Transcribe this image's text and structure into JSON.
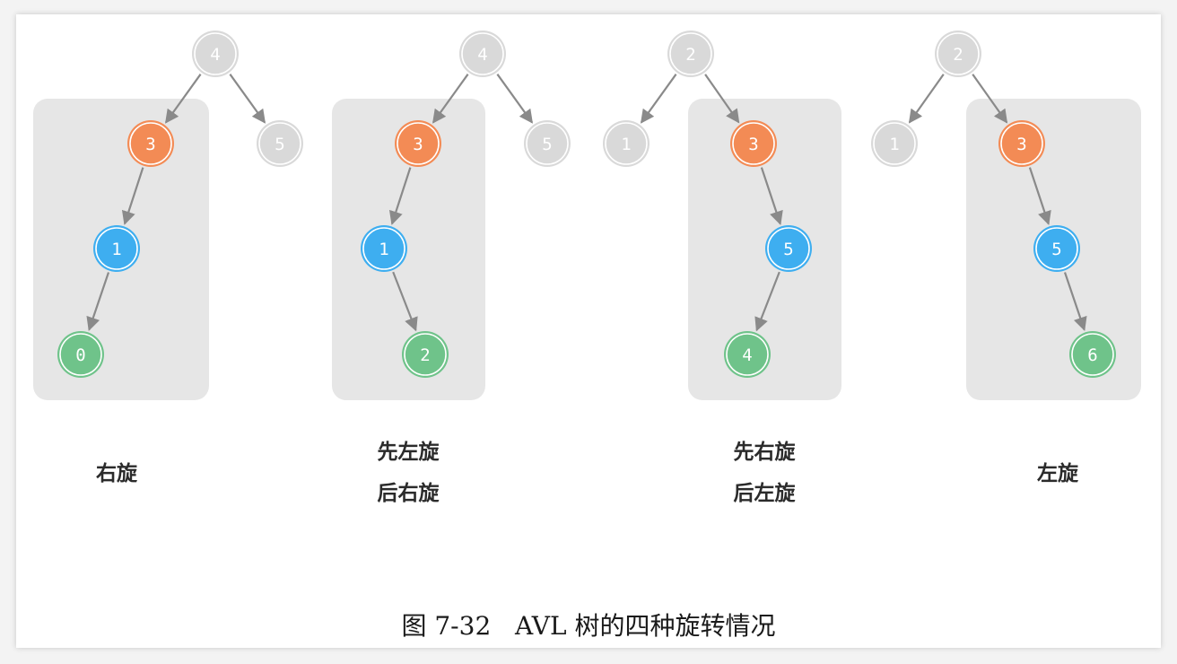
{
  "colors": {
    "faded_node": "#d9d9d9",
    "highlight_node": "#f38b55",
    "child_node": "#3eaef0",
    "grandchild_node": "#6fc38a",
    "panel": "#e6e6e6",
    "edge": "#8a8a8a"
  },
  "cases": [
    {
      "label_lines": [
        "右旋"
      ],
      "nodes": [
        {
          "id": "root",
          "value": "4",
          "role": "faded"
        },
        {
          "id": "unbalanced",
          "value": "3",
          "role": "highlight"
        },
        {
          "id": "sibling",
          "value": "5",
          "role": "faded"
        },
        {
          "id": "child",
          "value": "1",
          "role": "child"
        },
        {
          "id": "grandchild",
          "value": "0",
          "role": "grandchild"
        }
      ]
    },
    {
      "label_lines": [
        "先左旋",
        "后右旋"
      ],
      "nodes": [
        {
          "id": "root",
          "value": "4",
          "role": "faded"
        },
        {
          "id": "unbalanced",
          "value": "3",
          "role": "highlight"
        },
        {
          "id": "sibling",
          "value": "5",
          "role": "faded"
        },
        {
          "id": "child",
          "value": "1",
          "role": "child"
        },
        {
          "id": "grandchild",
          "value": "2",
          "role": "grandchild"
        }
      ]
    },
    {
      "label_lines": [
        "先右旋",
        "后左旋"
      ],
      "nodes": [
        {
          "id": "root",
          "value": "2",
          "role": "faded"
        },
        {
          "id": "sibling",
          "value": "1",
          "role": "faded"
        },
        {
          "id": "unbalanced",
          "value": "3",
          "role": "highlight"
        },
        {
          "id": "child",
          "value": "5",
          "role": "child"
        },
        {
          "id": "grandchild",
          "value": "4",
          "role": "grandchild"
        }
      ]
    },
    {
      "label_lines": [
        "左旋"
      ],
      "nodes": [
        {
          "id": "root",
          "value": "2",
          "role": "faded"
        },
        {
          "id": "sibling",
          "value": "1",
          "role": "faded"
        },
        {
          "id": "unbalanced",
          "value": "3",
          "role": "highlight"
        },
        {
          "id": "child",
          "value": "5",
          "role": "child"
        },
        {
          "id": "grandchild",
          "value": "6",
          "role": "grandchild"
        }
      ]
    }
  ],
  "caption": "图 7-32   AVL 树的四种旋转情况"
}
